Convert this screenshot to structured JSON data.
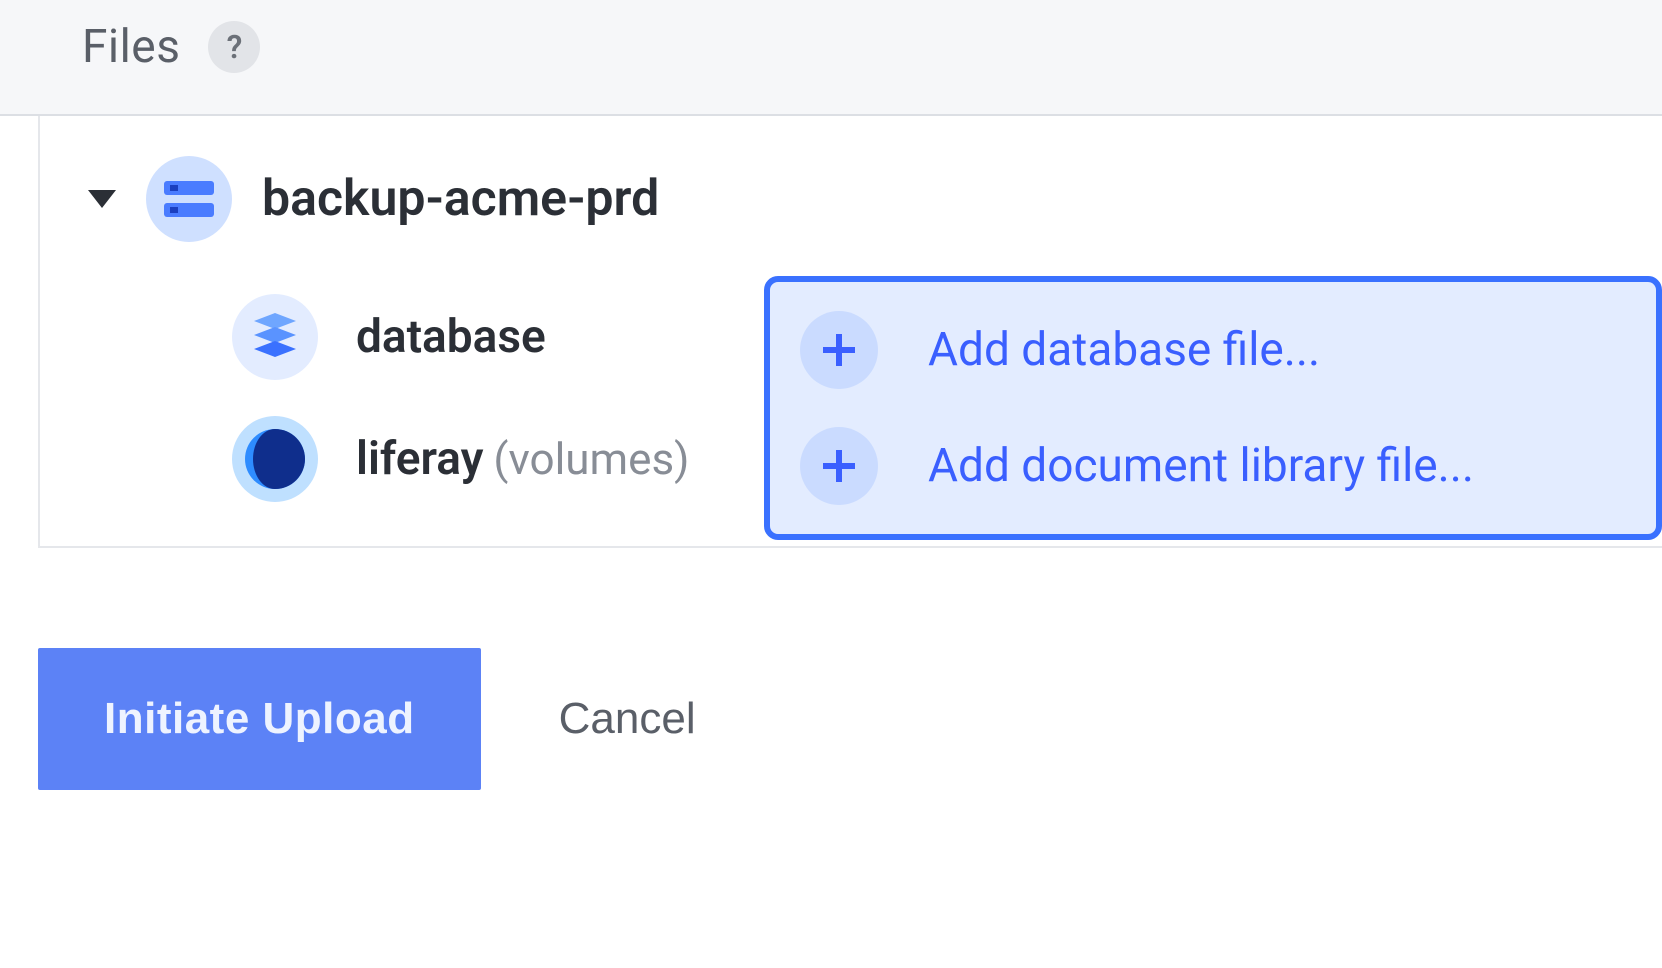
{
  "header": {
    "title": "Files",
    "help_glyph": "?"
  },
  "tree": {
    "root_label": "backup-acme-prd",
    "children": [
      {
        "label": "database",
        "sublabel": ""
      },
      {
        "label": "liferay",
        "sublabel": "(volumes)"
      }
    ]
  },
  "uploads": {
    "add_database_label": "Add database file...",
    "add_doclib_label": "Add document library file..."
  },
  "actions": {
    "primary": "Initiate Upload",
    "cancel": "Cancel"
  }
}
